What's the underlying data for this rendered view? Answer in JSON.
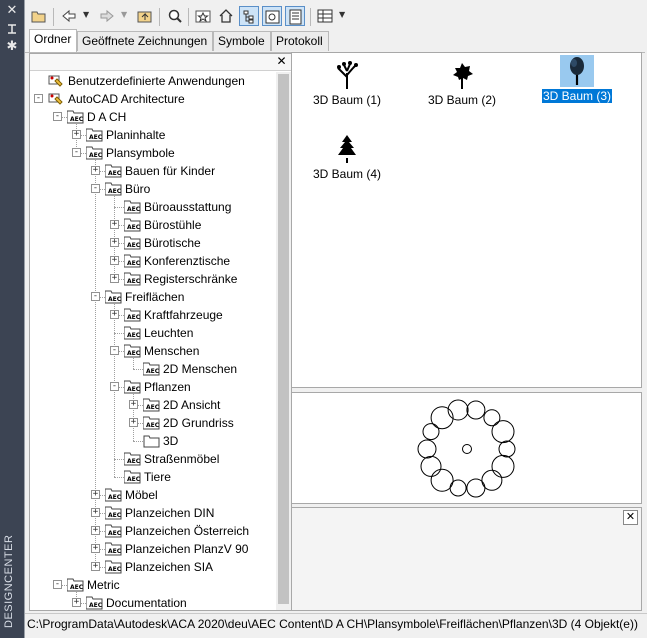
{
  "side_strip": {
    "label": "DESIGNCENTER",
    "icons": [
      "close-icon",
      "auto-hide-icon",
      "properties-icon"
    ]
  },
  "toolbar": {
    "buttons": [
      "open-icon",
      "back-icon",
      "forward-icon",
      "up-icon",
      "search-icon",
      "favorites-icon",
      "home-icon",
      "tree-toggle-icon",
      "preview-icon",
      "description-icon",
      "views-icon"
    ]
  },
  "tabs": [
    "Ordner",
    "Geöffnete Zeichnungen",
    "Symbole",
    "Protokoll"
  ],
  "tree": [
    {
      "label": "Benutzerdefinierte Anwendungen",
      "level": 0,
      "expander": "",
      "icon": "custom-app-icon"
    },
    {
      "label": "AutoCAD Architecture",
      "level": 0,
      "expander": "-",
      "icon": "custom-app-icon"
    },
    {
      "label": "D A CH",
      "level": 1,
      "expander": "-",
      "icon": "aec-folder-icon"
    },
    {
      "label": "Planinhalte",
      "level": 2,
      "expander": "+",
      "icon": "aec-folder-icon"
    },
    {
      "label": "Plansymbole",
      "level": 2,
      "expander": "-",
      "icon": "aec-folder-icon"
    },
    {
      "label": "Bauen für Kinder",
      "level": 3,
      "expander": "+",
      "icon": "aec-folder-icon"
    },
    {
      "label": "Büro",
      "level": 3,
      "expander": "-",
      "icon": "aec-folder-icon"
    },
    {
      "label": "Büroausstattung",
      "level": 4,
      "expander": "",
      "icon": "aec-folder-icon"
    },
    {
      "label": "Bürostühle",
      "level": 4,
      "expander": "+",
      "icon": "aec-folder-icon"
    },
    {
      "label": "Bürotische",
      "level": 4,
      "expander": "+",
      "icon": "aec-folder-icon"
    },
    {
      "label": "Konferenztische",
      "level": 4,
      "expander": "+",
      "icon": "aec-folder-icon"
    },
    {
      "label": "Registerschränke",
      "level": 4,
      "expander": "+",
      "icon": "aec-folder-icon"
    },
    {
      "label": "Freiflächen",
      "level": 3,
      "expander": "-",
      "icon": "aec-folder-icon"
    },
    {
      "label": "Kraftfahrzeuge",
      "level": 4,
      "expander": "+",
      "icon": "aec-folder-icon"
    },
    {
      "label": "Leuchten",
      "level": 4,
      "expander": "",
      "icon": "aec-folder-icon"
    },
    {
      "label": "Menschen",
      "level": 4,
      "expander": "-",
      "icon": "aec-folder-icon"
    },
    {
      "label": "2D Menschen",
      "level": 5,
      "expander": "",
      "icon": "aec-folder-icon"
    },
    {
      "label": "Pflanzen",
      "level": 4,
      "expander": "-",
      "icon": "aec-folder-icon"
    },
    {
      "label": "2D Ansicht",
      "level": 5,
      "expander": "+",
      "icon": "aec-folder-icon"
    },
    {
      "label": "2D Grundriss",
      "level": 5,
      "expander": "+",
      "icon": "aec-folder-icon"
    },
    {
      "label": "3D",
      "level": 5,
      "expander": "",
      "icon": "folder-icon"
    },
    {
      "label": "Straßenmöbel",
      "level": 4,
      "expander": "",
      "icon": "aec-folder-icon"
    },
    {
      "label": "Tiere",
      "level": 4,
      "expander": "",
      "icon": "aec-folder-icon"
    },
    {
      "label": "Möbel",
      "level": 3,
      "expander": "+",
      "icon": "aec-folder-icon"
    },
    {
      "label": "Planzeichen DIN",
      "level": 3,
      "expander": "+",
      "icon": "aec-folder-icon"
    },
    {
      "label": "Planzeichen Österreich",
      "level": 3,
      "expander": "+",
      "icon": "aec-folder-icon"
    },
    {
      "label": "Planzeichen PlanzV 90",
      "level": 3,
      "expander": "+",
      "icon": "aec-folder-icon"
    },
    {
      "label": "Planzeichen SIA",
      "level": 3,
      "expander": "+",
      "icon": "aec-folder-icon"
    },
    {
      "label": "Metric",
      "level": 1,
      "expander": "-",
      "icon": "aec-folder-icon"
    },
    {
      "label": "Documentation",
      "level": 2,
      "expander": "+",
      "icon": "aec-folder-icon"
    }
  ],
  "content_items": [
    {
      "label": "3D Baum (1)",
      "selected": false,
      "icon": "tree-1-icon"
    },
    {
      "label": "3D Baum (2)",
      "selected": false,
      "icon": "tree-2-icon"
    },
    {
      "label": "3D Baum (3)",
      "selected": true,
      "icon": "tree-3-icon"
    },
    {
      "label": "3D Baum (4)",
      "selected": false,
      "icon": "tree-4-icon"
    }
  ],
  "status_text": "C:\\ProgramData\\Autodesk\\ACA 2020\\deu\\AEC Content\\D A CH\\Plansymbole\\Freiflächen\\Pflanzen\\3D (4 Objekt(e))",
  "colors": {
    "selection": "#0078d7",
    "strip": "#3c4453",
    "toggle_active": "#cde3f7"
  }
}
